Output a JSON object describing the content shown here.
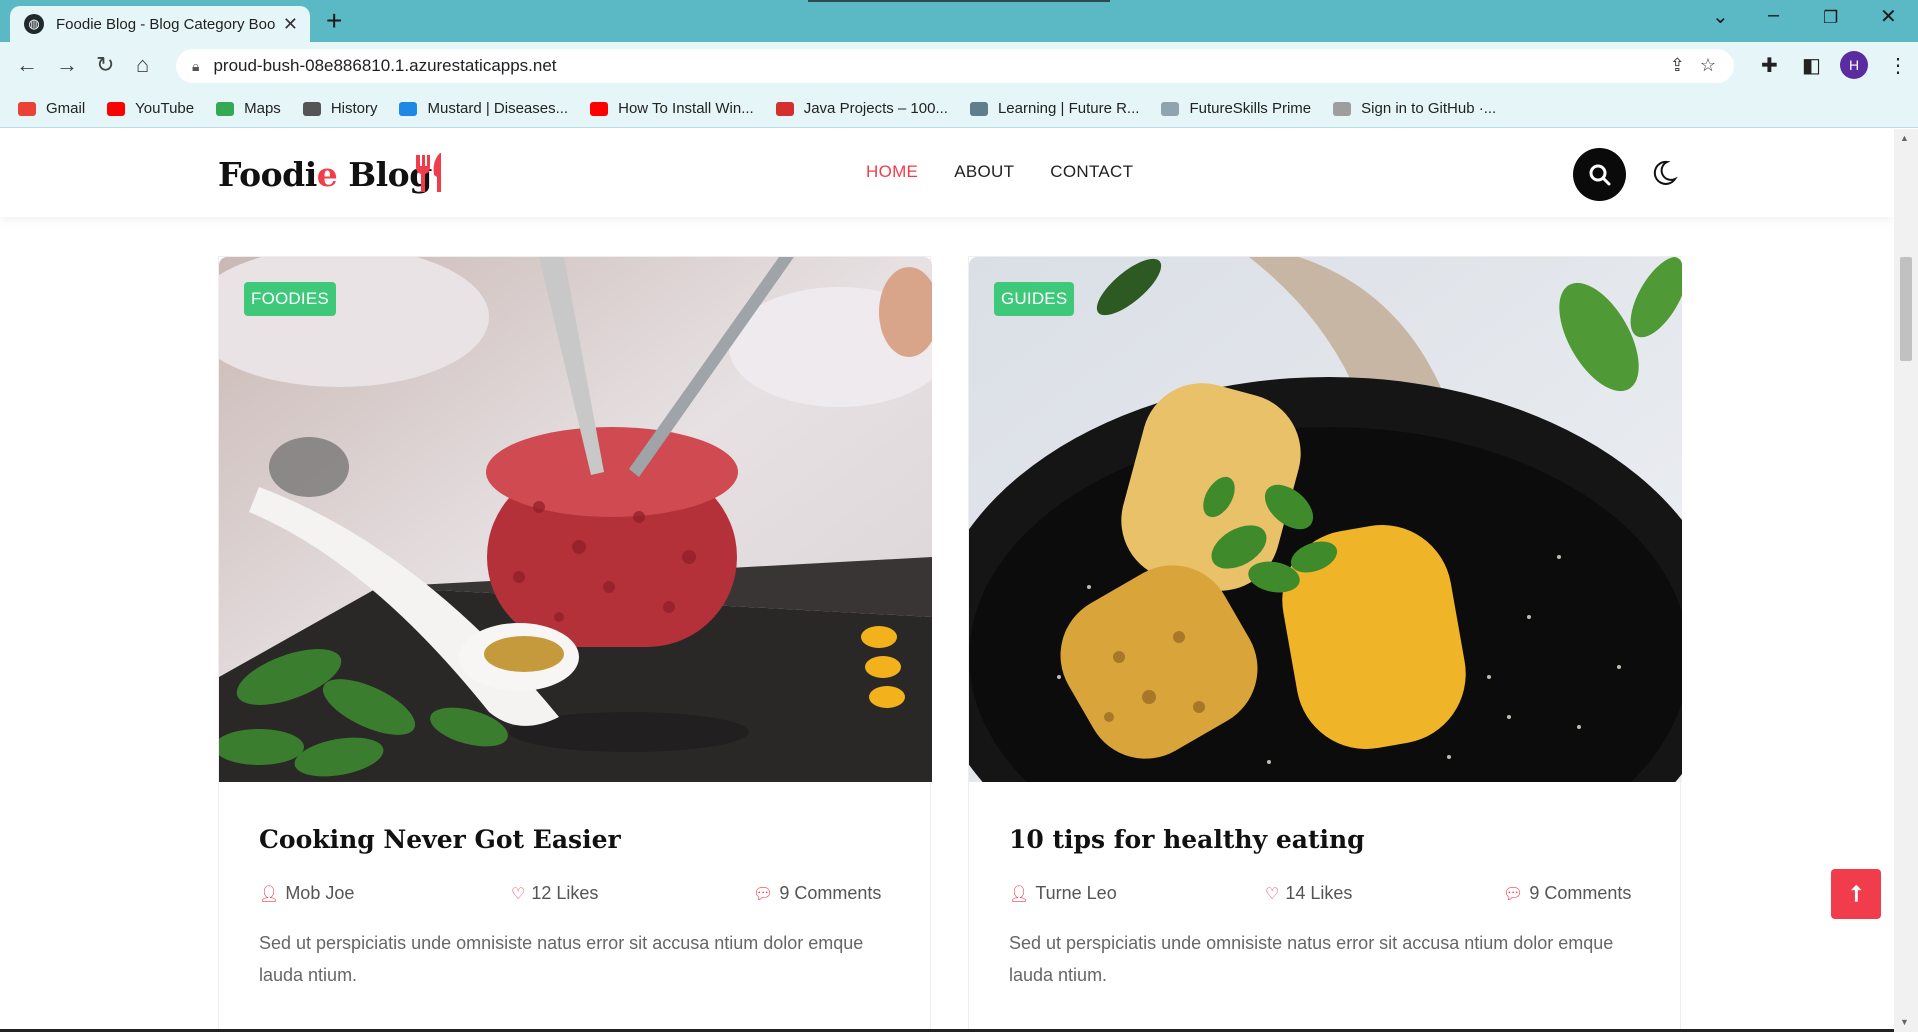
{
  "browser": {
    "tab_title": "Foodie Blog - Blog Category Boo",
    "tab_close": "✕",
    "new_tab": "+",
    "url": "proud-bush-08e886810.1.azurestaticapps.net",
    "profile_initial": "H",
    "bookmarks": [
      {
        "label": "Gmail",
        "color": "#ea4335",
        "icon": "gmail-icon"
      },
      {
        "label": "YouTube",
        "color": "#ff0000",
        "icon": "youtube-icon"
      },
      {
        "label": "Maps",
        "color": "#34a853",
        "icon": "maps-icon"
      },
      {
        "label": "History",
        "color": "#555555",
        "icon": "history-icon"
      },
      {
        "label": "Mustard | Diseases...",
        "color": "#1e88e5",
        "icon": "mustard-icon"
      },
      {
        "label": "How To Install Win...",
        "color": "#ff0000",
        "icon": "youtube-icon"
      },
      {
        "label": "Java Projects – 100...",
        "color": "#d32f2f",
        "icon": "java-projects-icon"
      },
      {
        "label": "Learning | Future R...",
        "color": "#607d8b",
        "icon": "learning-icon"
      },
      {
        "label": "FutureSkills Prime",
        "color": "#90a4ae",
        "icon": "futureskills-icon"
      },
      {
        "label": "Sign in to GitHub ·...",
        "color": "#9e9e9e",
        "icon": "github-icon"
      }
    ]
  },
  "site": {
    "logo_main": "Foodi",
    "logo_accent": "e",
    "logo_rest": " Blog",
    "nav": [
      {
        "label": "HOME",
        "active": true
      },
      {
        "label": "ABOUT",
        "active": false
      },
      {
        "label": "CONTACT",
        "active": false
      }
    ],
    "accent_color": "#f03c4b",
    "badge_color": "#3ec87a"
  },
  "posts": [
    {
      "category": "FOODIES",
      "title": "Cooking Never Got Easier",
      "author": "Mob Joe",
      "likes": "12 Likes",
      "comments": "9 Comments",
      "excerpt": "Sed ut perspiciatis unde omnisiste natus error sit accusa ntium dolor emque lauda ntium."
    },
    {
      "category": "GUIDES",
      "title": "10 tips for healthy eating",
      "author": "Turne Leo",
      "likes": "14 Likes",
      "comments": "9 Comments",
      "excerpt": "Sed ut perspiciatis unde omnisiste natus error sit accusa ntium dolor emque lauda ntium."
    }
  ],
  "back_to_top": "⭡"
}
